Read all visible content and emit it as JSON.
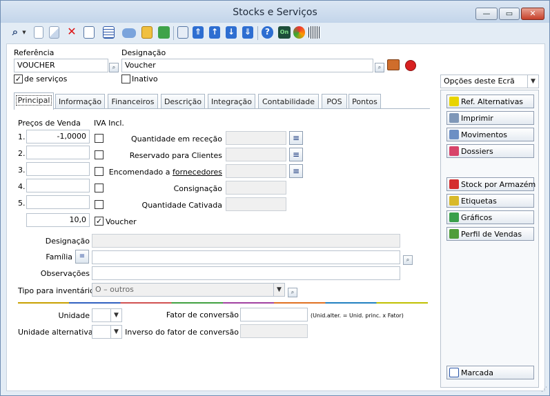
{
  "window": {
    "title": "Stocks e Serviços",
    "minimize_glyph": "—",
    "maximize_glyph": "▭",
    "close_glyph": "✕"
  },
  "toolbar": {
    "icons": [
      "search-icon",
      "new-document-icon",
      "copy-document-icon",
      "delete-icon",
      "properties-icon",
      "table-icon",
      "eraser-icon",
      "transfer-icon",
      "refresh-icon",
      "preview-icon",
      "first-record-icon",
      "previous-record-icon",
      "next-record-icon",
      "last-record-icon",
      "help-icon",
      "on-icon",
      "recycle-icon",
      "barcode-icon"
    ],
    "glyphs": {
      "search": "⌕",
      "first": "⇑",
      "prev": "↑",
      "next": "↓",
      "last": "⇓",
      "help": "?",
      "on": "On"
    }
  },
  "header": {
    "referencia_label": "Referência",
    "referencia_value": "VOUCHER",
    "designacao_label": "Designação",
    "designacao_value": "Voucher",
    "de_servicos_label": "de serviços",
    "de_servicos_checked": "✓",
    "inativo_label": "Inativo",
    "inativo_checked": ""
  },
  "tabs": [
    {
      "label": "Principal",
      "active": true
    },
    {
      "label": "Informação"
    },
    {
      "label": "Financeiros"
    },
    {
      "label": "Descrição"
    },
    {
      "label": "Integração"
    },
    {
      "label": "Contabilidade"
    },
    {
      "label": "POS"
    },
    {
      "label": "Pontos"
    }
  ],
  "principal": {
    "precos_label": "Preços de Venda",
    "iva_label": "IVA Incl.",
    "prices": [
      {
        "num": "1.",
        "value": "-1,0000",
        "iva": ""
      },
      {
        "num": "2.",
        "value": "",
        "iva": ""
      },
      {
        "num": "3.",
        "value": "",
        "iva": ""
      },
      {
        "num": "4.",
        "value": "",
        "iva": ""
      },
      {
        "num": "5.",
        "value": "",
        "iva": ""
      }
    ],
    "voucher_value": "10,0",
    "voucher_label": "Voucher",
    "voucher_checked": "✓",
    "qty_receipt_label": "Quantidade em receção",
    "reserved_label": "Reservado para Clientes",
    "ordered_label_prefix": "Encomendado a ",
    "ordered_label_link": "fornecedores",
    "consignacao_label": "Consignação",
    "cativada_label": "Quantidade Cativada",
    "designacao_label": "Designação",
    "familia_label": "Família",
    "observacoes_label": "Observações",
    "tipo_inventario_label": "Tipo para inventário",
    "tipo_inventario_value": "O – outros",
    "unidade_label": "Unidade",
    "unidade_alt_label": "Unidade alternativa",
    "fator_label": "Fator de conversão",
    "fator_hint": "(Unid.alter. = Unid. princ. x Fator)",
    "inverso_label": "Inverso do fator de conversão",
    "lines_glyph": "≡",
    "search_glyph": "⌕",
    "dropdown_glyph": "▼"
  },
  "right_panel": {
    "options_label": "Opções deste Ecrã",
    "buttons": [
      {
        "label": "Ref. Alternativas",
        "icon": "alternatives-icon",
        "color": "#e8d400"
      },
      {
        "label": "Imprimir",
        "icon": "printer-icon",
        "color": "#7f97b8"
      },
      {
        "label": "Movimentos",
        "icon": "movements-icon",
        "color": "#6c8fc4"
      },
      {
        "label": "Dossiers",
        "icon": "dossiers-icon",
        "color": "#d8446a"
      }
    ],
    "buttons2": [
      {
        "label": "Stock por Armazém",
        "icon": "warehouse-icon",
        "color": "#d42e2e"
      },
      {
        "label": "Etiquetas",
        "icon": "labels-icon",
        "color": "#d8b92a"
      },
      {
        "label": "Gráficos",
        "icon": "chart-icon",
        "color": "#3aa04b"
      },
      {
        "label": "Perfil de Vendas",
        "icon": "sales-profile-icon",
        "color": "#4f9d3a"
      }
    ],
    "marcada_label": "Marcada"
  },
  "colors": {
    "accent": "#1e5fbf",
    "window_bg": "#e3ecf5",
    "rainbow": [
      "#c8a000",
      "#3060c0",
      "#d05050",
      "#40a040",
      "#a040a0",
      "#e07020",
      "#2080c0",
      "#c0c000"
    ]
  }
}
